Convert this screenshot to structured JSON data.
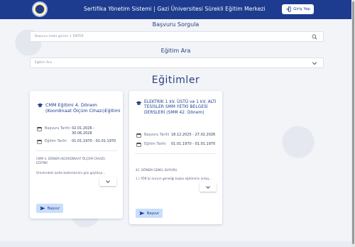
{
  "header": {
    "title": "Sertifika Yönetim Sistemi | Gazi Üniversitesi Sürekli Eğitim Merkezi",
    "login_label": "Giriş Yap"
  },
  "search": {
    "title": "Başvuru Sorgula",
    "placeholder": "Başvuru kodu giriniz + ENTER",
    "icon": "search-icon"
  },
  "filter": {
    "title": "Eğitim Ara",
    "selected": "Eğitim Ara",
    "icon": "chevron-down-icon"
  },
  "trainings": {
    "title": "Eğitimler",
    "cards": [
      {
        "title": "CMM Eğitimi 4. Dönem (Koordinaat Ölçüm Cihazı)Eğitimi",
        "application_label": "Başvuru Tarihi",
        "application_value": "02.01.2026 - 30.06.2026",
        "training_label": "Eğitim Tarihi",
        "training_value": "01.01.1970 - 01.01.1970",
        "desc_title": "CMM 4. DÖNEM (KOORDİNAAT ÖLÇÜM CİHAZI) EĞİTİMİ",
        "desc_text": "Ürünlerdeki kalite beklentisinin gün geçtikçe...",
        "apply_label": "Başvur"
      },
      {
        "title": "ELEKTRİK 1 kV. ÜSTÜ ve 1 kV. ALTI TESİSLER SMM YETKİ BELGESİ DERSLERİ (SMM 42. Dönem)",
        "application_label": "Başvuru Tarihi",
        "application_value": "18.12.2025 - 27.02.2026",
        "training_label": "Eğitim Tarihi",
        "training_value": "01.01.1970 - 01.01.1970",
        "desc_title": "42. DÖNEM GENEL DUYURU",
        "desc_text": "1.) YÖK'ün kurum geneli̇ği̇ başka eğitiminin orduş...",
        "apply_label": "Başvur"
      }
    ]
  },
  "colors": {
    "header_bg": "#1d3c8f",
    "accent": "#1d3c8f",
    "apply_bg": "#c9defa",
    "page_bg": "#f2f4f8"
  }
}
